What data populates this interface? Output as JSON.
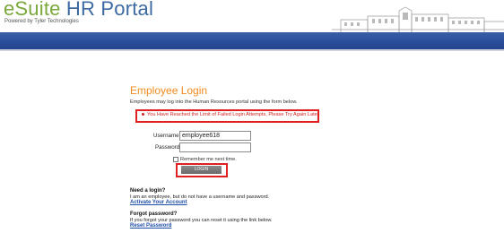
{
  "header": {
    "brand_part1": "eSuite",
    "brand_part2": " HR Portal",
    "subtitle": "Powered by Tyler Technologies"
  },
  "login": {
    "title": "Employee Login",
    "intro": "Employees may log into the Human Resources portal using the form below.",
    "error": "You Have Reached the Limit of Failed Login Attempts, Please Try Again Later",
    "username_label": "Username",
    "username_value": "employee618",
    "password_label": "Password",
    "password_value": "",
    "remember_label": "Remember me next time.",
    "login_button": "LOGIN"
  },
  "help": {
    "need_login_heading": "Need a login?",
    "need_login_text": "I am an employee, but do not have a username and password.",
    "activate_link": "Activate Your Account",
    "forgot_heading": "Forgot password?",
    "forgot_text": "If you forgot your password you can reset it using the link below.",
    "reset_link": "Reset Password"
  },
  "colors": {
    "brand_green": "#7aa83a",
    "brand_blue": "#3d6aa3",
    "banner": "#2b4e9b",
    "title_orange": "#f28b1e",
    "error_red": "#d42020",
    "link_blue": "#1f4fa8"
  }
}
